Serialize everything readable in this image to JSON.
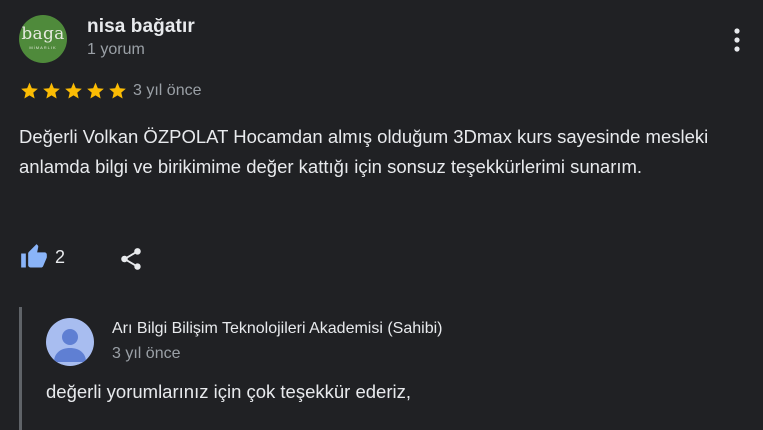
{
  "review": {
    "author_name": "nisa bağatır",
    "author_review_count": "1 yorum",
    "avatar_logo_text": "baga",
    "avatar_logo_subtext": "MİMARLIK",
    "rating": 5,
    "rating_max": 5,
    "time": "3 yıl önce",
    "text": "Değerli Volkan ÖZPOLAT Hocamdan almış olduğum 3Dmax kurs sayesinde mesleki anlamda bilgi ve birikimime değer kattığı için sonsuz teşekkürlerimi sunarım.",
    "like_count": "2"
  },
  "owner_response": {
    "name": "Arı Bilgi Bilişim Teknolojileri Akademisi (Sahibi)",
    "time": "3 yıl önce",
    "text": "değerli yorumlarınız için çok teşekkür ederiz,"
  },
  "icons": {
    "more": "more-vert-icon",
    "star": "star-icon",
    "like": "thumb-up-icon",
    "share": "share-icon",
    "owner_avatar": "person-icon"
  },
  "colors": {
    "background": "#202124",
    "text_primary": "#e8eaed",
    "text_secondary": "#9aa0a6",
    "star": "#fbbc04",
    "like_icon": "#8ab4f8",
    "avatar_main_bg": "#4f8a3b",
    "avatar_owner_bg": "#a8bdf0",
    "avatar_owner_fg": "#5f7fd3"
  }
}
